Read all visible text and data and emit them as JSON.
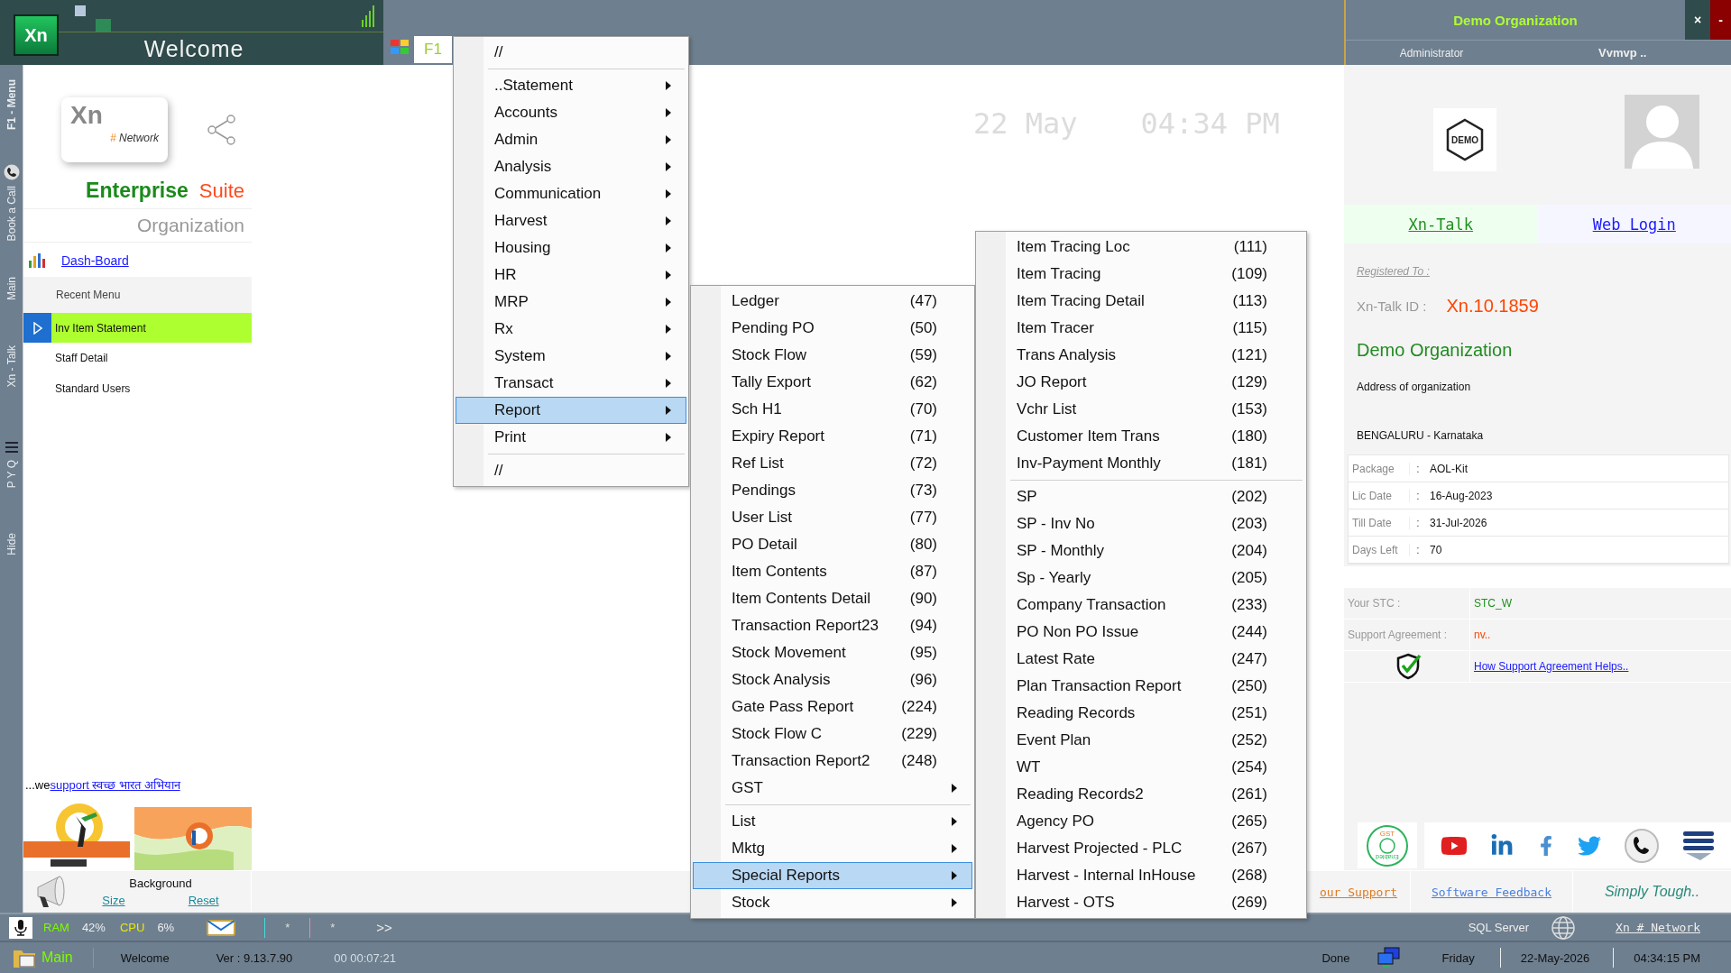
{
  "header": {
    "logo": "Xn",
    "title": "Welcome",
    "tab": "F1"
  },
  "side_tabs": [
    {
      "label": "F1 - Menu",
      "kind": "text"
    },
    {
      "label": "Book a Call",
      "kind": "call"
    },
    {
      "label": "Main",
      "kind": "text"
    },
    {
      "label": "Xn - Talk",
      "kind": "text"
    },
    {
      "label": "P Y Q",
      "kind": "list"
    },
    {
      "label": "Hide",
      "kind": "text"
    }
  ],
  "brand": {
    "logo": "Xn",
    "logo_tag_mark": "#",
    "logo_tag": "Network",
    "name": "Enterprise",
    "suffix": "Suite",
    "subtitle": "Organization"
  },
  "dashboard_link": "Dash-Board",
  "recent_menu": {
    "title": "Recent Menu",
    "items": [
      {
        "label": "Inv Item Statement",
        "selected": true
      },
      {
        "label": "Staff Detail",
        "selected": false
      },
      {
        "label": "Standard Users",
        "selected": false
      }
    ]
  },
  "campaign": {
    "prefix": "...we",
    "link": "support स्वच्छ भारत अभियान"
  },
  "background": {
    "title": "Background",
    "size_link": "Size",
    "reset_link": "Reset"
  },
  "clock": {
    "date": "22 May",
    "time": "04:34 PM"
  },
  "org_panel": {
    "title": "Demo Organization",
    "close": "×",
    "minimize": "-",
    "user": "Administrator",
    "account": "Vvmvp ..",
    "demo_badge": "DEMO",
    "talk_link": "Xn-Talk",
    "web_link": "Web Login",
    "registered_label": "Registered To :",
    "talk_id_label": "Xn-Talk ID :",
    "talk_id": "Xn.10.1859",
    "org_name": "Demo Organization",
    "address": "Address of organization",
    "city": "BENGALURU - Karnataka",
    "license": [
      {
        "label": "Package",
        "sep": ":",
        "value": "AOL-Kit"
      },
      {
        "label": "Lic Date",
        "sep": ":",
        "value": "16-Aug-2023"
      },
      {
        "label": "Till Date",
        "sep": ":",
        "value": "31-Jul-2026"
      },
      {
        "label": "Days Left",
        "sep": ":",
        "value": "70"
      }
    ],
    "stc_label": "Your STC :",
    "stc": "STC_W",
    "support_label": "Support Agreement :",
    "support": "nv..",
    "help_link": "How Support Agreement Helps..",
    "gst_top": "GST",
    "gst_bottom": "Enabled"
  },
  "footer_links": [
    {
      "label": "our Support",
      "kind": "support"
    },
    {
      "label": "Software Feedback",
      "kind": "feedback"
    },
    {
      "label": "Simply Tough..",
      "kind": "slogan"
    }
  ],
  "status_bar": {
    "ram_label": "RAM",
    "ram": "42%",
    "cpu_label": "CPU",
    "cpu": "6%",
    "mark_1": "*",
    "mark_2": "*",
    "more": ">>",
    "server": "SQL Server",
    "network": "Xn # Network"
  },
  "status_bar_2": {
    "module": "Main",
    "screen": "Welcome",
    "version": "Ver : 9.13.7.90",
    "elapsed": "00 00:07:21",
    "state": "Done",
    "day": "Friday",
    "date": "22-May-2026",
    "time": "04:34:15 PM"
  },
  "main_menu": [
    {
      "label": "//",
      "kind": "plain",
      "selected": false
    },
    {
      "kind": "separator"
    },
    {
      "label": "..Statement",
      "kind": "submenu",
      "selected": false
    },
    {
      "label": "Accounts",
      "kind": "submenu",
      "selected": false
    },
    {
      "label": "Admin",
      "kind": "submenu",
      "selected": false
    },
    {
      "label": "Analysis",
      "kind": "submenu",
      "selected": false
    },
    {
      "label": "Communication",
      "kind": "submenu",
      "selected": false
    },
    {
      "label": "Harvest",
      "kind": "submenu",
      "selected": false
    },
    {
      "label": "Housing",
      "kind": "submenu",
      "selected": false
    },
    {
      "label": "HR",
      "kind": "submenu",
      "selected": false
    },
    {
      "label": "MRP",
      "kind": "submenu",
      "selected": false
    },
    {
      "label": "Rx",
      "kind": "submenu",
      "selected": false
    },
    {
      "label": "System",
      "kind": "submenu",
      "selected": false
    },
    {
      "label": "Transact",
      "kind": "submenu",
      "selected": false
    },
    {
      "label": "Report",
      "kind": "submenu",
      "selected": true
    },
    {
      "label": "Print",
      "kind": "submenu",
      "selected": false
    },
    {
      "kind": "separator"
    },
    {
      "label": "//",
      "kind": "plain",
      "selected": false
    }
  ],
  "report_menu": [
    {
      "label": "Ledger",
      "code": "(47)",
      "kind": "report",
      "selected": false
    },
    {
      "label": "Pending PO",
      "code": "(50)",
      "kind": "report",
      "selected": false
    },
    {
      "label": "Stock Flow",
      "code": "(59)",
      "kind": "report",
      "selected": false
    },
    {
      "label": "Tally Export",
      "code": "(62)",
      "kind": "report",
      "selected": false
    },
    {
      "label": "Sch H1",
      "code": "(70)",
      "kind": "report",
      "selected": false
    },
    {
      "label": "Expiry Report",
      "code": "(71)",
      "kind": "report",
      "selected": false
    },
    {
      "label": "Ref List",
      "code": "(72)",
      "kind": "report",
      "selected": false
    },
    {
      "label": "Pendings",
      "code": "(73)",
      "kind": "report",
      "selected": false
    },
    {
      "label": "User List",
      "code": "(77)",
      "kind": "report",
      "selected": false
    },
    {
      "label": "PO Detail",
      "code": "(80)",
      "kind": "report",
      "selected": false
    },
    {
      "label": "Item Contents",
      "code": "(87)",
      "kind": "report",
      "selected": false
    },
    {
      "label": "Item Contents Detail",
      "code": "(90)",
      "kind": "report",
      "selected": false
    },
    {
      "label": "Transaction Report23",
      "code": "(94)",
      "kind": "report",
      "selected": false
    },
    {
      "label": "Stock Movement",
      "code": "(95)",
      "kind": "report",
      "selected": false
    },
    {
      "label": "Stock Analysis",
      "code": "(96)",
      "kind": "report",
      "selected": false
    },
    {
      "label": "Gate Pass Report",
      "code": "(224)",
      "kind": "report",
      "selected": false
    },
    {
      "label": "Stock Flow C",
      "code": "(229)",
      "kind": "report",
      "selected": false
    },
    {
      "label": "Transaction Report2",
      "code": "(248)",
      "kind": "report",
      "selected": false
    },
    {
      "label": "GST",
      "kind": "submenu",
      "selected": false
    },
    {
      "kind": "separator"
    },
    {
      "label": "List",
      "kind": "submenu",
      "selected": false
    },
    {
      "label": "Mktg",
      "kind": "submenu",
      "selected": false
    },
    {
      "label": "Special Reports",
      "kind": "submenu",
      "selected": true
    },
    {
      "label": "Stock",
      "kind": "submenu",
      "selected": false
    }
  ],
  "special_reports_menu": [
    {
      "label": "Item Tracing Loc",
      "code": "(111)",
      "kind": "report",
      "selected": false
    },
    {
      "label": "Item Tracing",
      "code": "(109)",
      "kind": "report",
      "selected": false
    },
    {
      "label": "Item Tracing Detail",
      "code": "(113)",
      "kind": "report",
      "selected": false
    },
    {
      "label": "Item Tracer",
      "code": "(115)",
      "kind": "report",
      "selected": false
    },
    {
      "label": "Trans Analysis",
      "code": "(121)",
      "kind": "report",
      "selected": false
    },
    {
      "label": "JO Report",
      "code": "(129)",
      "kind": "report",
      "selected": false
    },
    {
      "label": "Vchr List",
      "code": "(153)",
      "kind": "report",
      "selected": false
    },
    {
      "label": "Customer Item Trans",
      "code": "(180)",
      "kind": "report",
      "selected": false
    },
    {
      "label": "Inv-Payment Monthly",
      "code": "(181)",
      "kind": "report",
      "selected": false
    },
    {
      "kind": "separator"
    },
    {
      "label": "SP",
      "code": "(202)",
      "kind": "report",
      "selected": false
    },
    {
      "label": "SP - Inv No",
      "code": "(203)",
      "kind": "report",
      "selected": false
    },
    {
      "label": "SP - Monthly",
      "code": "(204)",
      "kind": "report",
      "selected": false
    },
    {
      "label": "Sp - Yearly",
      "code": "(205)",
      "kind": "report",
      "selected": false
    },
    {
      "label": "Company Transaction",
      "code": "(233)",
      "kind": "report",
      "selected": false
    },
    {
      "label": "PO Non PO Issue",
      "code": "(244)",
      "kind": "report",
      "selected": false
    },
    {
      "label": "Latest Rate",
      "code": "(247)",
      "kind": "report",
      "selected": false
    },
    {
      "label": "Plan Transaction Report",
      "code": "(250)",
      "kind": "report",
      "selected": false
    },
    {
      "label": "Reading Records",
      "code": "(251)",
      "kind": "report",
      "selected": false
    },
    {
      "label": "Event Plan",
      "code": "(252)",
      "kind": "report",
      "selected": false
    },
    {
      "label": "WT",
      "code": "(254)",
      "kind": "report",
      "selected": false
    },
    {
      "label": "Reading Records2",
      "code": "(261)",
      "kind": "report",
      "selected": false
    },
    {
      "label": "Agency PO",
      "code": "(265)",
      "kind": "report",
      "selected": false
    },
    {
      "label": "Harvest Projected - PLC",
      "code": "(267)",
      "kind": "report",
      "selected": false
    },
    {
      "label": "Harvest - Internal InHouse",
      "code": "(268)",
      "kind": "report",
      "selected": false
    },
    {
      "label": "Harvest - OTS",
      "code": "(269)",
      "kind": "report",
      "selected": false
    }
  ]
}
